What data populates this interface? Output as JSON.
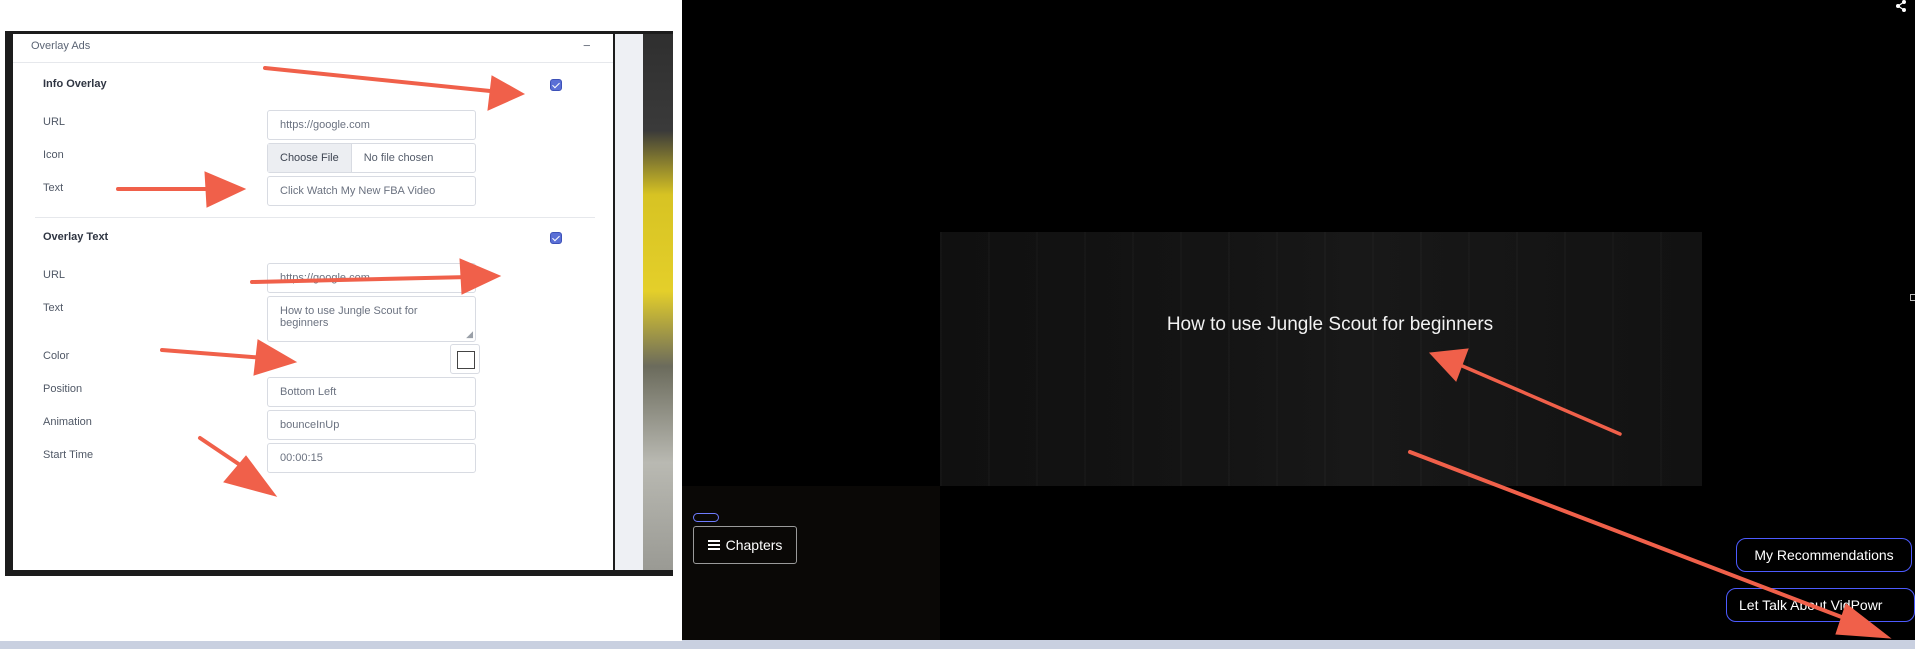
{
  "form": {
    "section_title": "Overlay Ads",
    "collapse_symbol": "−",
    "info_overlay": {
      "heading": "Info Overlay",
      "checked": true,
      "url_label": "URL",
      "url_value": "https://google.com",
      "icon_label": "Icon",
      "file_button": "Choose File",
      "file_status": "No file chosen",
      "text_label": "Text",
      "text_value": "Click Watch My New FBA Video"
    },
    "overlay_text": {
      "heading": "Overlay Text",
      "checked": true,
      "url_label": "URL",
      "url_value": "https://google.com",
      "text_label": "Text",
      "text_value": "How to use Jungle Scout for beginners",
      "color_label": "Color",
      "color_value": "#ffffff",
      "position_label": "Position",
      "position_value": "Bottom Left",
      "animation_label": "Animation",
      "animation_value": "bounceInUp",
      "start_time_label": "Start Time",
      "start_time_value": "00:00:15"
    }
  },
  "player": {
    "overlay_text": "How to use Jungle Scout for beginners",
    "chapters_label": "Chapters",
    "recommendations_label": "My Recommendations",
    "talk_label": "Let Talk About VidPowr",
    "icons": {
      "menu": "hamburger-icon",
      "share": "share-icon"
    }
  },
  "annotation_color": "#f0604a"
}
